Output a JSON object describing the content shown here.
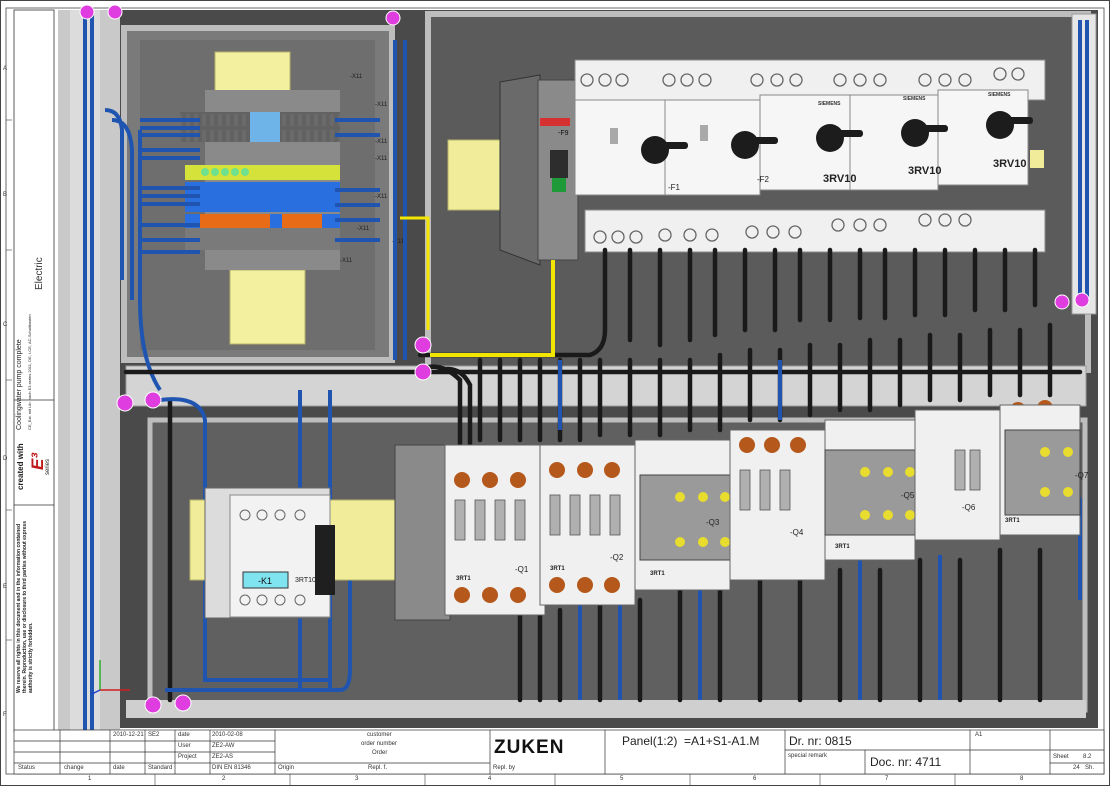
{
  "drawing": {
    "company_logo": "ZUKEN",
    "title": "Panel(1:2)  =A1+S1-A1.M",
    "drawing_number": "Dr. nr: 0815",
    "document_number": "Doc. nr: 4711",
    "sheet_ref": "A1",
    "customer_label": "customer",
    "order_number_label": "order number",
    "order_label": "Order",
    "special_remark_label": "special remark",
    "sheet_label": "Sheet",
    "sheet_value": "8.2",
    "sheets_total": "24",
    "sheets_abbr": "Sh.",
    "status_label": "Status",
    "change_label": "change",
    "date_label": "date",
    "name_label": "name",
    "standard_label": "Standard",
    "origin_label": "Origin",
    "repl_label": "Repl. f.",
    "repl_by_label": "Repl. by",
    "user_label": "User",
    "project_label": "Project",
    "date_value_1": "2010-12-21",
    "name_value_1": "SE2",
    "date_value_2": "2010-02-08",
    "user_value": "ZE2-AW",
    "project_value": "ZE2-AS",
    "standard_value": "DIN EN 81346"
  },
  "sidebar": {
    "created_with": "created with",
    "product": "Coolingwater pump complete",
    "product_sub": "CE_Ext. mit Lib. nach E3.series 2011, DE, I-CE, AC-Schaltkasten",
    "brand_e3": "E³",
    "brand_series": "series",
    "brand_electric": "Electric",
    "copyright": "We reserve all rights in this document and in the information contained therein. Reproduction, use or disclosure to third parties without express authority is strictly forbidden."
  },
  "grid": {
    "columns": [
      "1",
      "2",
      "3",
      "4",
      "5",
      "6",
      "7",
      "8"
    ],
    "rows": [
      "A",
      "B",
      "C",
      "D",
      "E",
      "F"
    ]
  },
  "components": {
    "terminal_labels": [
      "-X11",
      "-X11",
      "-X11",
      "-X11",
      "-X11",
      "-X11",
      "-X11",
      "-X11"
    ],
    "breaker_f9": "-F9",
    "switch_labels": [
      "-F1",
      "-F2"
    ],
    "motor_breaker_brand": "SIEMENS",
    "motor_breaker_model": "3RV10",
    "contactor_k1": "-K1",
    "contactor_k1_model": "3RT10",
    "contactor_model": "3RT1",
    "contactor_labels": [
      "-Q1",
      "-Q2",
      "-Q3",
      "-Q4",
      "-Q5",
      "-Q6",
      "-Q7"
    ]
  },
  "colors": {
    "panel_bg": "#4a4a4a",
    "wire_blue": "#1f55b0",
    "wire_black": "#1a1a1a",
    "wire_yellow": "#f2e500",
    "marker_pink": "#e03de0",
    "highlight_cyan": "#7fe3f0"
  }
}
